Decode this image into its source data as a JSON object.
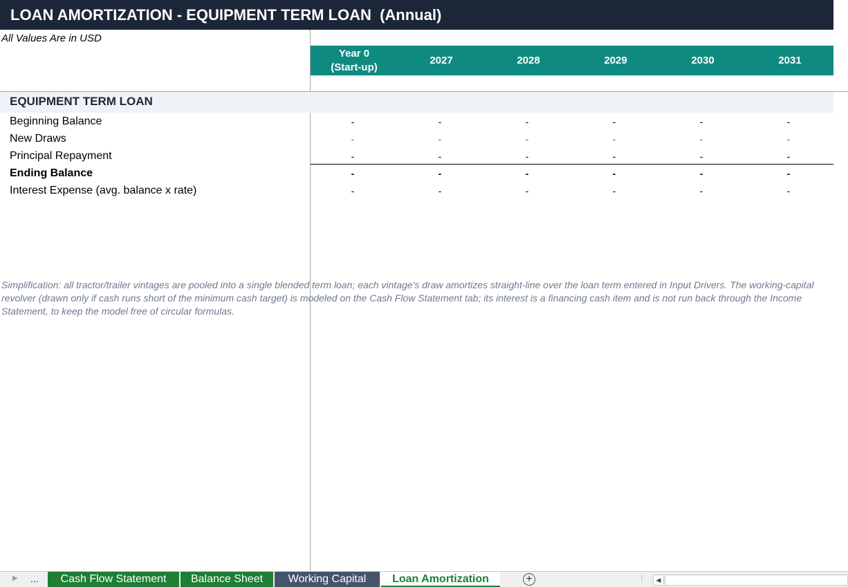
{
  "title": "LOAN AMORTIZATION - EQUIPMENT TERM LOAN  (Annual)",
  "units_note": "All Values Are in USD",
  "header": {
    "columns": [
      "Year 0\n(Start-up)",
      "2027",
      "2028",
      "2029",
      "2030",
      "2031"
    ],
    "band_color": "#0e8a80"
  },
  "section": {
    "title": "EQUIPMENT TERM LOAN"
  },
  "rows": [
    {
      "label": "Beginning Balance",
      "values": [
        "-",
        "-",
        "-",
        "-",
        "-",
        "-"
      ]
    },
    {
      "label": "New Draws",
      "values": [
        "-",
        "-",
        "-",
        "-",
        "-",
        "-"
      ]
    },
    {
      "label": "Principal Repayment",
      "values": [
        "-",
        "-",
        "-",
        "-",
        "-",
        "-"
      ]
    },
    {
      "label": "Ending Balance",
      "values": [
        "-",
        "-",
        "-",
        "-",
        "-",
        "-"
      ]
    },
    {
      "label": "Interest Expense (avg. balance x rate)",
      "values": [
        "-",
        "-",
        "-",
        "-",
        "-",
        "-"
      ]
    }
  ],
  "footnote": "Simplification: all tractor/trailer vintages are pooled into a single blended term loan; each vintage's draw amortizes straight-line over the loan term entered in Input Drivers. The working-capital revolver (drawn only if cash runs short of the minimum cash target) is modeled on the Cash Flow Statement tab; its interest is a financing cash item and is not run back through the Income Statement, to keep the model free of circular formulas.",
  "tabs": {
    "ellipsis": "...",
    "items": [
      "Cash Flow Statement",
      "Balance Sheet",
      "Working Capital",
      "Loan Amortization"
    ],
    "active": "Loan Amortization",
    "add_icon": "plus-circle-icon",
    "add_glyph": "+",
    "split_glyph": "⋮"
  },
  "colors": {
    "title_bg": "#1c2639",
    "accent_teal": "#0e8a80",
    "tab_green": "#1e7e34",
    "tab_slate": "#44546a",
    "section_bg": "#eff2f7",
    "footnote_text": "#6e7a8e"
  }
}
